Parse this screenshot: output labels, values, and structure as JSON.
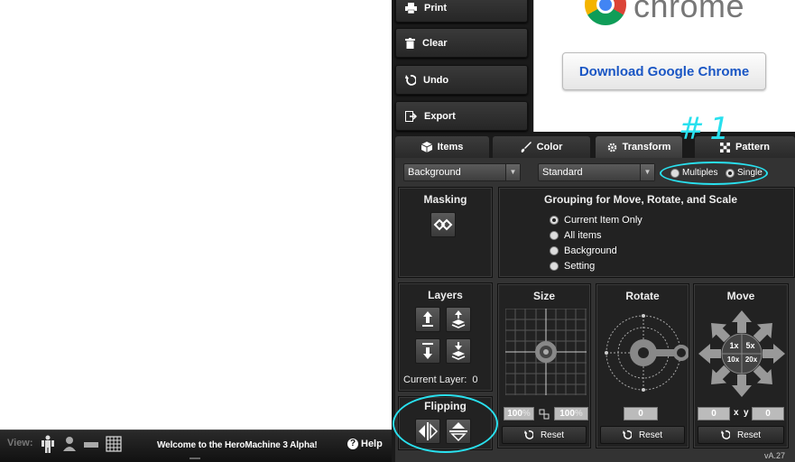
{
  "bottom_bar": {
    "view_label": "View:",
    "welcome_text": "Welcome to the HeroMachine 3 Alpha!",
    "help_label": "Help"
  },
  "actions": {
    "print_label": "Print",
    "clear_label": "Clear",
    "undo_label": "Undo",
    "export_label": "Export"
  },
  "ad": {
    "logo_word": "chrome",
    "download_label": "Download Google Chrome"
  },
  "tabs": [
    {
      "label": "Items"
    },
    {
      "label": "Color"
    },
    {
      "label": "Transform"
    },
    {
      "label": "Pattern"
    }
  ],
  "controls": {
    "layer_select": "Background",
    "mode_select": "Standard",
    "multiples_label": "Multiples",
    "single_label": "Single",
    "annotation_text": "#1"
  },
  "masking": {
    "title": "Masking"
  },
  "grouping": {
    "title": "Grouping for Move, Rotate, and Scale",
    "options": [
      {
        "label": "Current Item Only",
        "selected": true
      },
      {
        "label": "All items",
        "selected": false
      },
      {
        "label": "Background",
        "selected": false
      },
      {
        "label": "Setting",
        "selected": false
      }
    ]
  },
  "layers": {
    "title": "Layers",
    "current_layer_label": "Current Layer:",
    "current_layer_value": "0"
  },
  "flipping": {
    "title": "Flipping"
  },
  "size": {
    "title": "Size",
    "width_value": "100",
    "height_value": "100",
    "unit": "%",
    "reset_label": "Reset"
  },
  "rotate": {
    "title": "Rotate",
    "value": "0",
    "reset_label": "Reset"
  },
  "move": {
    "title": "Move",
    "step_1x": "1x",
    "step_5x": "5x",
    "step_10x": "10x",
    "step_20x": "20x",
    "x_value": "0",
    "x_label": "x",
    "y_label": "y",
    "y_value": "0",
    "reset_label": "Reset"
  },
  "version": "vA.27",
  "colors": {
    "annotation": "#29e0ee",
    "chrome_blue": "#1a56c4"
  }
}
